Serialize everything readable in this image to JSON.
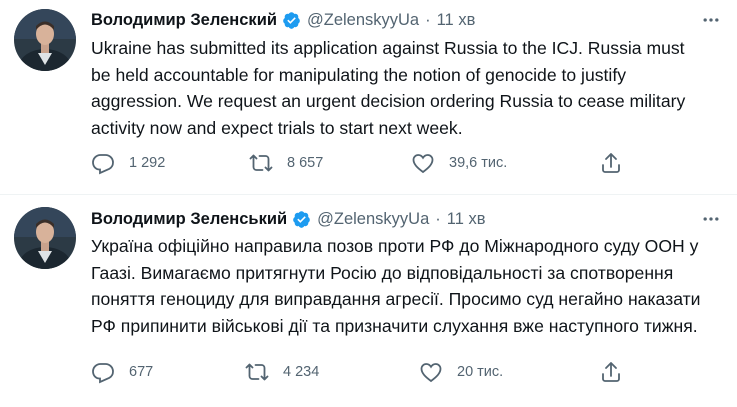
{
  "colors": {
    "verified": "#1d9bf0",
    "text": "#0f1419",
    "secondary": "#536471",
    "divider": "#eff3f4"
  },
  "tweets": [
    {
      "author": {
        "name": "Володимир Зеленский",
        "handle": "@ZelenskyyUa",
        "verified": true
      },
      "separator": "·",
      "time": "11 хв",
      "text": "Ukraine has submitted its application against Russia to the ICJ. Russia must be held accountable for manipulating the notion of genocide to justify aggression. We request an urgent decision ordering Russia to cease military activity now and expect trials to start next week.",
      "actions": {
        "replies": "1 292",
        "retweets": "8 657",
        "likes": "39,6 тис."
      },
      "icons": [
        "reply-icon",
        "retweet-icon",
        "like-icon",
        "share-icon",
        "more-icon",
        "verified-badge-icon"
      ]
    },
    {
      "author": {
        "name": "Володимир Зеленський",
        "handle": "@ZelenskyyUa",
        "verified": true
      },
      "separator": "·",
      "time": "11 хв",
      "text": "Україна офіційно направила позов проти РФ до Міжнародного суду ООН у Гаазі. Вимагаємо притягнути Росію до відповідальності за спотворення поняття геноциду для виправдання агресії. Просимо суд негайно наказати РФ припинити військові дії та призначити слухання вже наступного тижня.",
      "actions": {
        "replies": "677",
        "retweets": "4 234",
        "likes": "20 тис."
      },
      "icons": [
        "reply-icon",
        "retweet-icon",
        "like-icon",
        "share-icon",
        "more-icon",
        "verified-badge-icon"
      ]
    }
  ]
}
